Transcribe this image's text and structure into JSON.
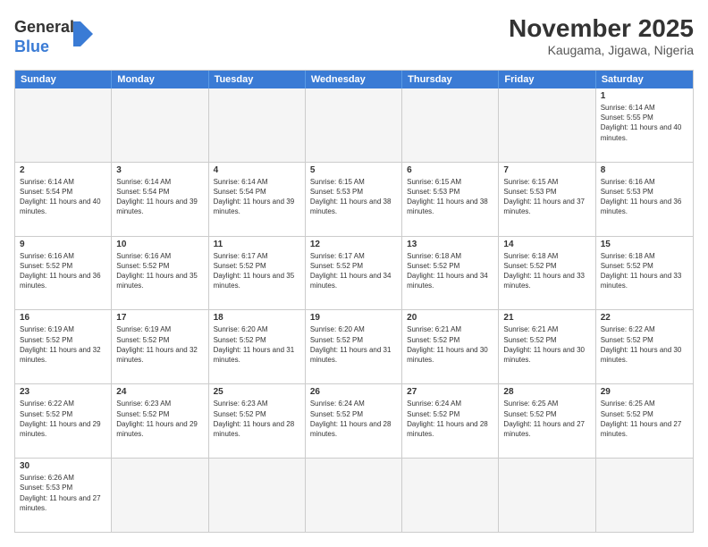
{
  "header": {
    "logo_general": "General",
    "logo_blue": "Blue",
    "month_title": "November 2025",
    "location": "Kaugama, Jigawa, Nigeria"
  },
  "days_of_week": [
    "Sunday",
    "Monday",
    "Tuesday",
    "Wednesday",
    "Thursday",
    "Friday",
    "Saturday"
  ],
  "rows": [
    [
      {
        "day": "",
        "text": ""
      },
      {
        "day": "",
        "text": ""
      },
      {
        "day": "",
        "text": ""
      },
      {
        "day": "",
        "text": ""
      },
      {
        "day": "",
        "text": ""
      },
      {
        "day": "",
        "text": ""
      },
      {
        "day": "1",
        "text": "Sunrise: 6:14 AM\nSunset: 5:55 PM\nDaylight: 11 hours and 40 minutes."
      }
    ],
    [
      {
        "day": "2",
        "text": "Sunrise: 6:14 AM\nSunset: 5:54 PM\nDaylight: 11 hours and 40 minutes."
      },
      {
        "day": "3",
        "text": "Sunrise: 6:14 AM\nSunset: 5:54 PM\nDaylight: 11 hours and 39 minutes."
      },
      {
        "day": "4",
        "text": "Sunrise: 6:14 AM\nSunset: 5:54 PM\nDaylight: 11 hours and 39 minutes."
      },
      {
        "day": "5",
        "text": "Sunrise: 6:15 AM\nSunset: 5:53 PM\nDaylight: 11 hours and 38 minutes."
      },
      {
        "day": "6",
        "text": "Sunrise: 6:15 AM\nSunset: 5:53 PM\nDaylight: 11 hours and 38 minutes."
      },
      {
        "day": "7",
        "text": "Sunrise: 6:15 AM\nSunset: 5:53 PM\nDaylight: 11 hours and 37 minutes."
      },
      {
        "day": "8",
        "text": "Sunrise: 6:16 AM\nSunset: 5:53 PM\nDaylight: 11 hours and 36 minutes."
      }
    ],
    [
      {
        "day": "9",
        "text": "Sunrise: 6:16 AM\nSunset: 5:52 PM\nDaylight: 11 hours and 36 minutes."
      },
      {
        "day": "10",
        "text": "Sunrise: 6:16 AM\nSunset: 5:52 PM\nDaylight: 11 hours and 35 minutes."
      },
      {
        "day": "11",
        "text": "Sunrise: 6:17 AM\nSunset: 5:52 PM\nDaylight: 11 hours and 35 minutes."
      },
      {
        "day": "12",
        "text": "Sunrise: 6:17 AM\nSunset: 5:52 PM\nDaylight: 11 hours and 34 minutes."
      },
      {
        "day": "13",
        "text": "Sunrise: 6:18 AM\nSunset: 5:52 PM\nDaylight: 11 hours and 34 minutes."
      },
      {
        "day": "14",
        "text": "Sunrise: 6:18 AM\nSunset: 5:52 PM\nDaylight: 11 hours and 33 minutes."
      },
      {
        "day": "15",
        "text": "Sunrise: 6:18 AM\nSunset: 5:52 PM\nDaylight: 11 hours and 33 minutes."
      }
    ],
    [
      {
        "day": "16",
        "text": "Sunrise: 6:19 AM\nSunset: 5:52 PM\nDaylight: 11 hours and 32 minutes."
      },
      {
        "day": "17",
        "text": "Sunrise: 6:19 AM\nSunset: 5:52 PM\nDaylight: 11 hours and 32 minutes."
      },
      {
        "day": "18",
        "text": "Sunrise: 6:20 AM\nSunset: 5:52 PM\nDaylight: 11 hours and 31 minutes."
      },
      {
        "day": "19",
        "text": "Sunrise: 6:20 AM\nSunset: 5:52 PM\nDaylight: 11 hours and 31 minutes."
      },
      {
        "day": "20",
        "text": "Sunrise: 6:21 AM\nSunset: 5:52 PM\nDaylight: 11 hours and 30 minutes."
      },
      {
        "day": "21",
        "text": "Sunrise: 6:21 AM\nSunset: 5:52 PM\nDaylight: 11 hours and 30 minutes."
      },
      {
        "day": "22",
        "text": "Sunrise: 6:22 AM\nSunset: 5:52 PM\nDaylight: 11 hours and 30 minutes."
      }
    ],
    [
      {
        "day": "23",
        "text": "Sunrise: 6:22 AM\nSunset: 5:52 PM\nDaylight: 11 hours and 29 minutes."
      },
      {
        "day": "24",
        "text": "Sunrise: 6:23 AM\nSunset: 5:52 PM\nDaylight: 11 hours and 29 minutes."
      },
      {
        "day": "25",
        "text": "Sunrise: 6:23 AM\nSunset: 5:52 PM\nDaylight: 11 hours and 28 minutes."
      },
      {
        "day": "26",
        "text": "Sunrise: 6:24 AM\nSunset: 5:52 PM\nDaylight: 11 hours and 28 minutes."
      },
      {
        "day": "27",
        "text": "Sunrise: 6:24 AM\nSunset: 5:52 PM\nDaylight: 11 hours and 28 minutes."
      },
      {
        "day": "28",
        "text": "Sunrise: 6:25 AM\nSunset: 5:52 PM\nDaylight: 11 hours and 27 minutes."
      },
      {
        "day": "29",
        "text": "Sunrise: 6:25 AM\nSunset: 5:52 PM\nDaylight: 11 hours and 27 minutes."
      }
    ],
    [
      {
        "day": "30",
        "text": "Sunrise: 6:26 AM\nSunset: 5:53 PM\nDaylight: 11 hours and 27 minutes."
      },
      {
        "day": "",
        "text": ""
      },
      {
        "day": "",
        "text": ""
      },
      {
        "day": "",
        "text": ""
      },
      {
        "day": "",
        "text": ""
      },
      {
        "day": "",
        "text": ""
      },
      {
        "day": "",
        "text": ""
      }
    ]
  ]
}
